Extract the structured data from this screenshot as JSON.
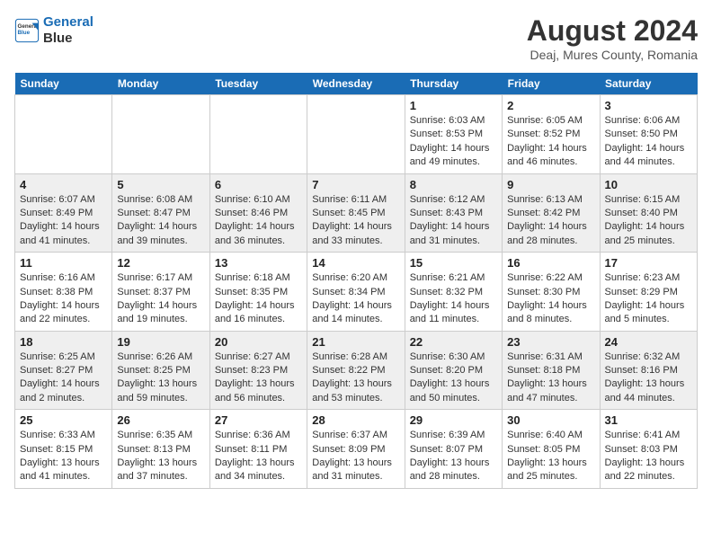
{
  "header": {
    "logo_line1": "General",
    "logo_line2": "Blue",
    "month_year": "August 2024",
    "location": "Deaj, Mures County, Romania"
  },
  "weekdays": [
    "Sunday",
    "Monday",
    "Tuesday",
    "Wednesday",
    "Thursday",
    "Friday",
    "Saturday"
  ],
  "weeks": [
    [
      {
        "day": "",
        "info": ""
      },
      {
        "day": "",
        "info": ""
      },
      {
        "day": "",
        "info": ""
      },
      {
        "day": "",
        "info": ""
      },
      {
        "day": "1",
        "info": "Sunrise: 6:03 AM\nSunset: 8:53 PM\nDaylight: 14 hours and 49 minutes."
      },
      {
        "day": "2",
        "info": "Sunrise: 6:05 AM\nSunset: 8:52 PM\nDaylight: 14 hours and 46 minutes."
      },
      {
        "day": "3",
        "info": "Sunrise: 6:06 AM\nSunset: 8:50 PM\nDaylight: 14 hours and 44 minutes."
      }
    ],
    [
      {
        "day": "4",
        "info": "Sunrise: 6:07 AM\nSunset: 8:49 PM\nDaylight: 14 hours and 41 minutes."
      },
      {
        "day": "5",
        "info": "Sunrise: 6:08 AM\nSunset: 8:47 PM\nDaylight: 14 hours and 39 minutes."
      },
      {
        "day": "6",
        "info": "Sunrise: 6:10 AM\nSunset: 8:46 PM\nDaylight: 14 hours and 36 minutes."
      },
      {
        "day": "7",
        "info": "Sunrise: 6:11 AM\nSunset: 8:45 PM\nDaylight: 14 hours and 33 minutes."
      },
      {
        "day": "8",
        "info": "Sunrise: 6:12 AM\nSunset: 8:43 PM\nDaylight: 14 hours and 31 minutes."
      },
      {
        "day": "9",
        "info": "Sunrise: 6:13 AM\nSunset: 8:42 PM\nDaylight: 14 hours and 28 minutes."
      },
      {
        "day": "10",
        "info": "Sunrise: 6:15 AM\nSunset: 8:40 PM\nDaylight: 14 hours and 25 minutes."
      }
    ],
    [
      {
        "day": "11",
        "info": "Sunrise: 6:16 AM\nSunset: 8:38 PM\nDaylight: 14 hours and 22 minutes."
      },
      {
        "day": "12",
        "info": "Sunrise: 6:17 AM\nSunset: 8:37 PM\nDaylight: 14 hours and 19 minutes."
      },
      {
        "day": "13",
        "info": "Sunrise: 6:18 AM\nSunset: 8:35 PM\nDaylight: 14 hours and 16 minutes."
      },
      {
        "day": "14",
        "info": "Sunrise: 6:20 AM\nSunset: 8:34 PM\nDaylight: 14 hours and 14 minutes."
      },
      {
        "day": "15",
        "info": "Sunrise: 6:21 AM\nSunset: 8:32 PM\nDaylight: 14 hours and 11 minutes."
      },
      {
        "day": "16",
        "info": "Sunrise: 6:22 AM\nSunset: 8:30 PM\nDaylight: 14 hours and 8 minutes."
      },
      {
        "day": "17",
        "info": "Sunrise: 6:23 AM\nSunset: 8:29 PM\nDaylight: 14 hours and 5 minutes."
      }
    ],
    [
      {
        "day": "18",
        "info": "Sunrise: 6:25 AM\nSunset: 8:27 PM\nDaylight: 14 hours and 2 minutes."
      },
      {
        "day": "19",
        "info": "Sunrise: 6:26 AM\nSunset: 8:25 PM\nDaylight: 13 hours and 59 minutes."
      },
      {
        "day": "20",
        "info": "Sunrise: 6:27 AM\nSunset: 8:23 PM\nDaylight: 13 hours and 56 minutes."
      },
      {
        "day": "21",
        "info": "Sunrise: 6:28 AM\nSunset: 8:22 PM\nDaylight: 13 hours and 53 minutes."
      },
      {
        "day": "22",
        "info": "Sunrise: 6:30 AM\nSunset: 8:20 PM\nDaylight: 13 hours and 50 minutes."
      },
      {
        "day": "23",
        "info": "Sunrise: 6:31 AM\nSunset: 8:18 PM\nDaylight: 13 hours and 47 minutes."
      },
      {
        "day": "24",
        "info": "Sunrise: 6:32 AM\nSunset: 8:16 PM\nDaylight: 13 hours and 44 minutes."
      }
    ],
    [
      {
        "day": "25",
        "info": "Sunrise: 6:33 AM\nSunset: 8:15 PM\nDaylight: 13 hours and 41 minutes."
      },
      {
        "day": "26",
        "info": "Sunrise: 6:35 AM\nSunset: 8:13 PM\nDaylight: 13 hours and 37 minutes."
      },
      {
        "day": "27",
        "info": "Sunrise: 6:36 AM\nSunset: 8:11 PM\nDaylight: 13 hours and 34 minutes."
      },
      {
        "day": "28",
        "info": "Sunrise: 6:37 AM\nSunset: 8:09 PM\nDaylight: 13 hours and 31 minutes."
      },
      {
        "day": "29",
        "info": "Sunrise: 6:39 AM\nSunset: 8:07 PM\nDaylight: 13 hours and 28 minutes."
      },
      {
        "day": "30",
        "info": "Sunrise: 6:40 AM\nSunset: 8:05 PM\nDaylight: 13 hours and 25 minutes."
      },
      {
        "day": "31",
        "info": "Sunrise: 6:41 AM\nSunset: 8:03 PM\nDaylight: 13 hours and 22 minutes."
      }
    ]
  ]
}
